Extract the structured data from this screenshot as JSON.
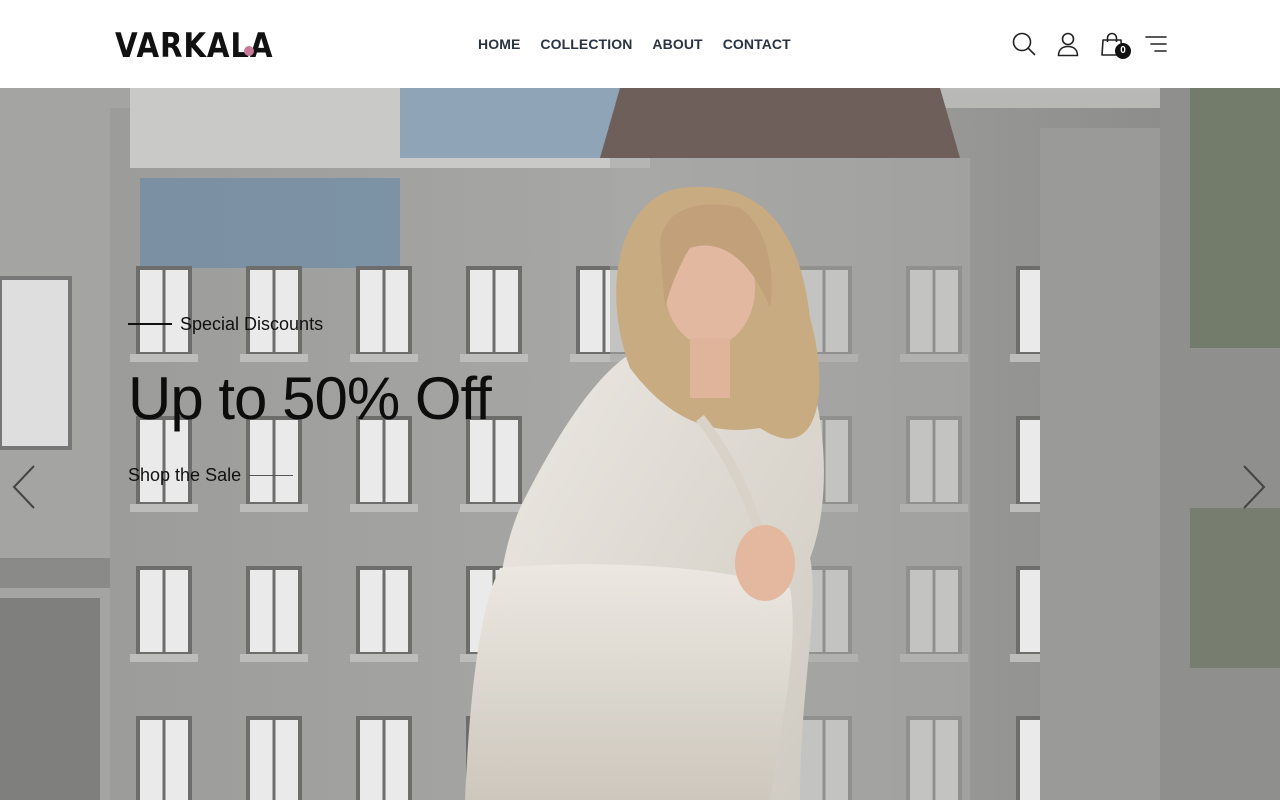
{
  "brand": {
    "name": "VARKALA",
    "dot_color": "#c97a9a"
  },
  "nav": {
    "items": [
      {
        "label": "HOME"
      },
      {
        "label": "COLLECTION"
      },
      {
        "label": "ABOUT"
      },
      {
        "label": "CONTACT"
      }
    ]
  },
  "header_icons": {
    "search": "search-icon",
    "account": "user-icon",
    "cart": "shopping-bag-icon",
    "menu": "menu-icon",
    "cart_count": "0"
  },
  "hero": {
    "eyebrow": "Special Discounts",
    "headline": "Up to 50% Off",
    "cta_label": "Shop the Sale",
    "prev_icon": "chevron-left-icon",
    "next_icon": "chevron-right-icon"
  }
}
